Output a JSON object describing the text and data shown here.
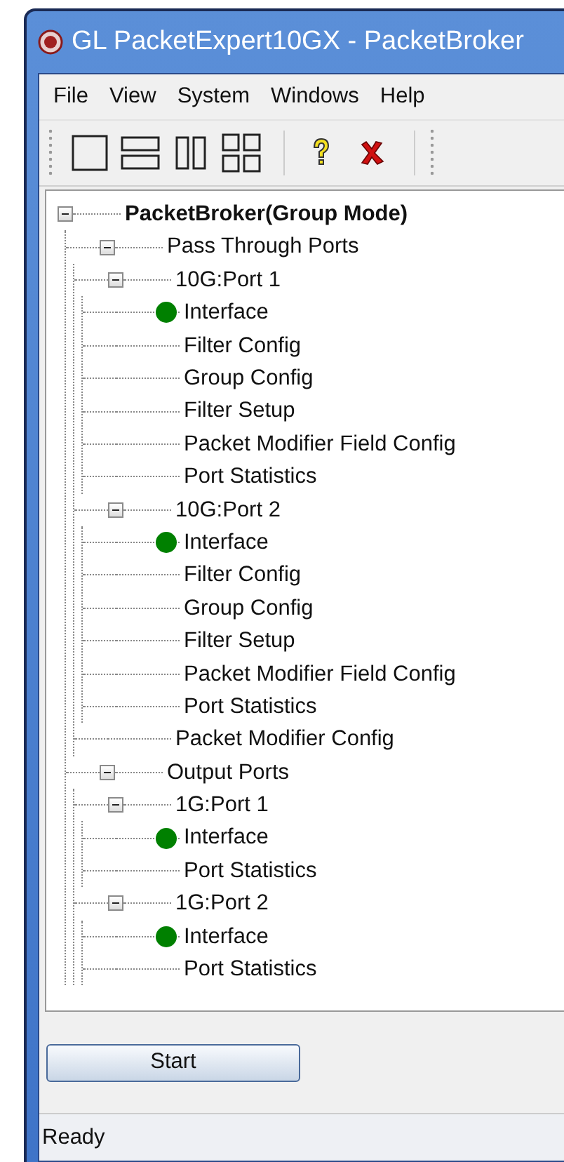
{
  "window": {
    "title": "GL PacketExpert10GX - PacketBroker"
  },
  "menu": [
    "File",
    "View",
    "System",
    "Windows",
    "Help"
  ],
  "tree": [
    {
      "label": "PacketBroker(Group Mode)",
      "bold": true,
      "expanded": true,
      "children": [
        {
          "label": "Pass Through Ports",
          "expanded": true,
          "children": [
            {
              "label": "10G:Port 1",
              "expanded": true,
              "children": [
                {
                  "label": "Interface",
                  "color": "#008000"
                },
                {
                  "label": "Filter Config"
                },
                {
                  "label": "Group Config"
                },
                {
                  "label": "Filter Setup"
                },
                {
                  "label": "Packet Modifier Field Config"
                },
                {
                  "label": "Port Statistics"
                }
              ]
            },
            {
              "label": "10G:Port 2",
              "expanded": true,
              "children": [
                {
                  "label": "Interface",
                  "color": "#008000"
                },
                {
                  "label": "Filter Config"
                },
                {
                  "label": "Group Config"
                },
                {
                  "label": "Filter Setup"
                },
                {
                  "label": "Packet Modifier Field Config"
                },
                {
                  "label": "Port Statistics"
                }
              ]
            },
            {
              "label": "Packet Modifier Config"
            }
          ]
        },
        {
          "label": "Output Ports",
          "expanded": true,
          "children": [
            {
              "label": "1G:Port 1",
              "expanded": true,
              "children": [
                {
                  "label": "Interface",
                  "color": "#008000"
                },
                {
                  "label": "Port Statistics"
                }
              ]
            },
            {
              "label": "1G:Port 2",
              "expanded": true,
              "children": [
                {
                  "label": "Interface",
                  "color": "#008000"
                },
                {
                  "label": "Port Statistics"
                }
              ]
            }
          ]
        }
      ]
    }
  ],
  "start_button": "Start",
  "status_bar": "Ready"
}
